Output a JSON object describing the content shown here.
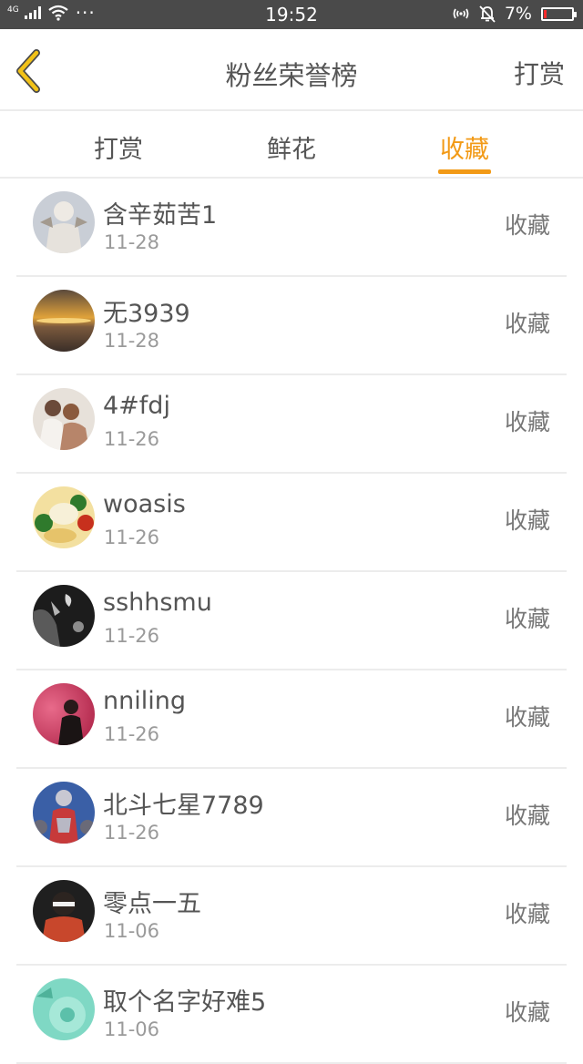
{
  "status_bar": {
    "network": "4G",
    "time": "19:52",
    "battery_percent": "7%",
    "battery_level": 0.07,
    "battery_color": "#ff2a2a"
  },
  "nav": {
    "back_icon": "chevron-left-icon",
    "title": "粉丝荣誉榜",
    "right_label": "打赏",
    "back_icon_color": "#f2c218"
  },
  "tabs": [
    {
      "label": "打赏",
      "active": false
    },
    {
      "label": "鲜花",
      "active": false
    },
    {
      "label": "收藏",
      "active": true
    }
  ],
  "accent_color": "#f29a16",
  "list": [
    {
      "name": "含辛茹苦1",
      "date": "11-28",
      "action": "收藏"
    },
    {
      "name": "无3939",
      "date": "11-28",
      "action": "收藏"
    },
    {
      "name": "4#fdj",
      "date": "11-26",
      "action": "收藏"
    },
    {
      "name": "woasis",
      "date": "11-26",
      "action": "收藏"
    },
    {
      "name": "sshhsmu",
      "date": "11-26",
      "action": "收藏"
    },
    {
      "name": "nniling",
      "date": "11-26",
      "action": "收藏"
    },
    {
      "name": "北斗七星7789",
      "date": "11-26",
      "action": "收藏"
    },
    {
      "name": "零点一五",
      "date": "11-06",
      "action": "收藏"
    },
    {
      "name": "取个名字好难5",
      "date": "11-06",
      "action": "收藏"
    }
  ]
}
